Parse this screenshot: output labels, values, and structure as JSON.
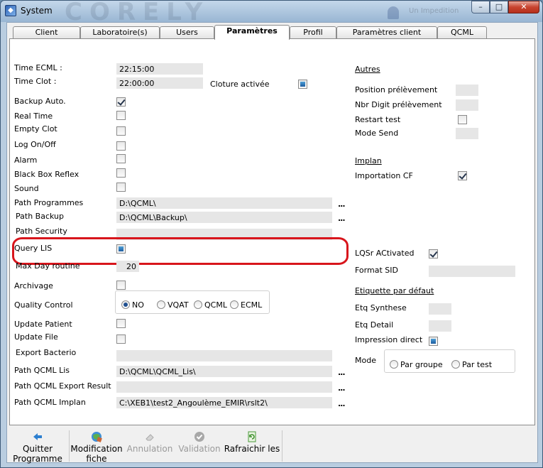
{
  "window": {
    "title": "System",
    "watermark": "CORELY",
    "user_text": "Un Impedition",
    "minimize_glyph": "–",
    "maximize_glyph": "□",
    "close_glyph": "✕"
  },
  "tabs": [
    "Client",
    "Laboratoire(s)",
    "Users",
    "Paramètres",
    "Profil",
    "Paramètres client",
    "QCML"
  ],
  "active_tab": "Paramètres",
  "left": {
    "time_ecml_label": "Time ECML :",
    "time_ecml_value": "22:15:00",
    "time_clot_label": "Time Clot :",
    "time_clot_value": "22:00:00",
    "cloture_label": "Cloture activée",
    "backup_auto_label": "Backup Auto.",
    "real_time_label": "Real Time",
    "empty_clot_label": "Empty Clot",
    "log_onoff_label": "Log On/Off",
    "alarm_label": " Alarm",
    "black_box_label": "Black Box Reflex",
    "sound_label": "Sound",
    "path_programmes_label": "Path Programmes",
    "path_programmes_value": "D:\\QCML\\",
    "path_backup_label": "Path Backup",
    "path_backup_value": "D:\\QCML\\Backup\\",
    "path_security_label": "Path Security",
    "path_security_value": "",
    "query_lis_label": "Query LIS",
    "max_day_label": "Max Day routine",
    "max_day_value": "20",
    "archivage_label": "Archivage",
    "quality_control_label": "Quality Control",
    "qc_options": [
      "NO",
      "VQAT",
      "QCML",
      "ECML"
    ],
    "qc_selected": "NO",
    "update_patient_label": "Update Patient",
    "update_file_label": "Update  File",
    "export_bacterio_label": "Export Bacterio",
    "export_bacterio_value": "",
    "path_qcml_lis_label": "Path QCML Lis",
    "path_qcml_lis_value": "D:\\QCML\\QCML_Lis\\",
    "path_qcml_export_label": "Path QCML Export Result",
    "path_qcml_export_value": "",
    "path_qcml_implan_label": "Path QCML Implan",
    "path_qcml_implan_value": "C:\\XEB1\\test2_Angoulème_EMIR\\rslt2\\",
    "browse_label": "..."
  },
  "right": {
    "autres_title": "Autres",
    "position_prelevement_label": "Position prélèvement",
    "nbr_digit_label": "Nbr Digit prélèvement",
    "restart_test_label": "Restart test",
    "mode_send_label": "Mode Send",
    "implan_title": "Implan",
    "importation_cf_label": "Importation CF",
    "lqsr_label": "LQSr ACtivated",
    "format_sid_label": "Format SID",
    "etiquette_title": "Etiquette par défaut",
    "etq_synthese_label": "Etq Synthese",
    "etq_detail_label": "Etq Detail",
    "impression_direct_label": "Impression direct",
    "mode_label": "Mode",
    "mode_options": [
      "Par groupe",
      "Par test"
    ],
    "mode_selected": ""
  },
  "checkboxes": {
    "cloture": "filled",
    "backup_auto": "checked",
    "real_time": "unchecked",
    "empty_clot": "unchecked",
    "log_onoff": "unchecked",
    "alarm": "unchecked",
    "black_box": "unchecked",
    "sound": "unchecked",
    "query_lis": "filled",
    "archivage": "unchecked",
    "update_patient": "unchecked",
    "update_file": "unchecked",
    "restart_test": "unchecked",
    "importation_cf": "checked",
    "lqsr": "checked",
    "impression_direct": "filled"
  },
  "toolbar": {
    "quitter_line1": "Quitter",
    "quitter_line2": "Programme",
    "modification_line1": "Modification",
    "modification_line2": "fiche",
    "annulation": "Annulation",
    "validation": "Validation",
    "rafraichir": "Rafraichir les"
  },
  "colors": {
    "highlight": "#d8151c",
    "field_bg": "#e6e6e6"
  }
}
